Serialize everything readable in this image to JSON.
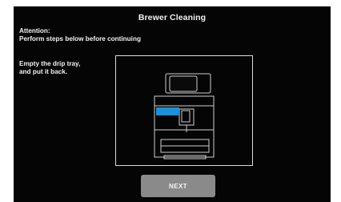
{
  "screen": {
    "title": "Brewer Cleaning",
    "attention": {
      "heading": "Attention:",
      "message": "Perform steps below before continuing"
    },
    "instruction": {
      "line1": "Empty the drip tray,",
      "line2": "and put it back."
    },
    "illustration": {
      "icon": "coffee-machine-drip-tray-icon",
      "highlight_color": "#1e90d8"
    },
    "next_button": {
      "label": "NEXT"
    }
  }
}
